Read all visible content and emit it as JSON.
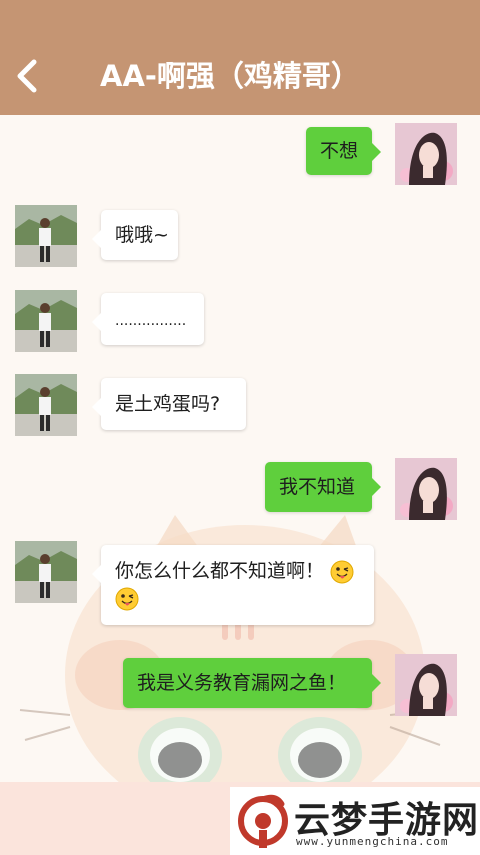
{
  "header": {
    "title": "AA-啊强（鸡精哥）",
    "back_icon": "chevron-left-icon",
    "background": "#c59573"
  },
  "messages": [
    {
      "side": "right",
      "sender": "self",
      "text": "不想"
    },
    {
      "side": "left",
      "sender": "contact",
      "text": "哦哦~"
    },
    {
      "side": "left",
      "sender": "contact",
      "text": "................"
    },
    {
      "side": "left",
      "sender": "contact",
      "text": "是土鸡蛋吗?"
    },
    {
      "side": "right",
      "sender": "self",
      "text": "我不知道"
    },
    {
      "side": "left",
      "sender": "contact",
      "text": "你怎么什么都不知道啊！",
      "emoji": [
        "winking-tongue-emoji",
        "winking-tongue-emoji"
      ]
    },
    {
      "side": "right",
      "sender": "self",
      "text": "我是义务教育漏网之鱼！"
    }
  ],
  "colors": {
    "self_bubble": "#5fcf3d",
    "contact_bubble": "#ffffff",
    "chat_background": "#fdf8f3"
  },
  "watermark": {
    "name": "云梦手游网",
    "url": "www.yunmengchina.com"
  }
}
